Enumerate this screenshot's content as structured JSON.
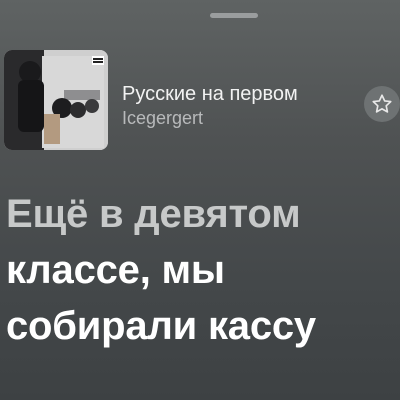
{
  "track": {
    "title": "Русские на первом",
    "artist": "Icegergert"
  },
  "icons": {
    "favorite": "star-outline-icon",
    "handle": "sheet-grabber"
  },
  "lyrics": {
    "lines": [
      "Ещё в девятом",
      "классе, мы",
      "собирали кассу"
    ],
    "current_line_index": 1
  },
  "colors": {
    "background": "#4f5253",
    "text_primary": "#ffffff",
    "text_secondary": "#b8babb"
  }
}
